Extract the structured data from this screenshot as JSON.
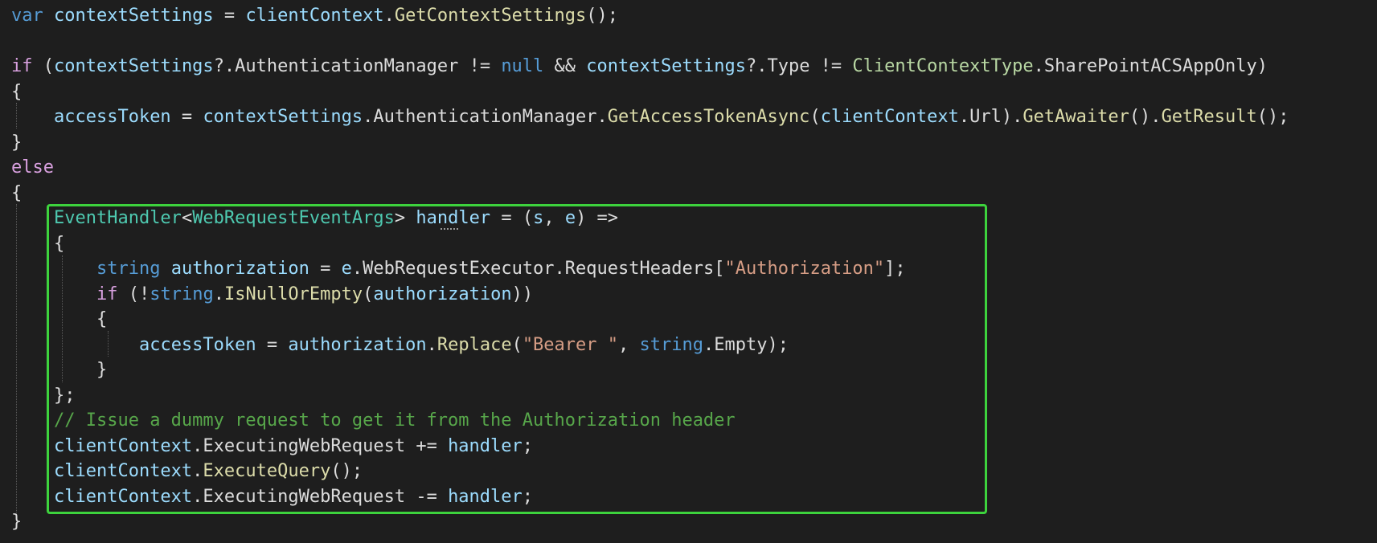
{
  "colors": {
    "background": "#1e1e1e",
    "highlight_border": "#3dd33d",
    "keyword": "#569cd6",
    "control_keyword": "#d8a0df",
    "identifier": "#9cdcfe",
    "method": "#dcdcaa",
    "type": "#4ec9b0",
    "enum": "#b8d7a3",
    "string": "#d69d85",
    "comment": "#57a64a",
    "punctuation": "#dcdcdc"
  },
  "code": [
    {
      "indent": 0,
      "tokens": [
        {
          "t": "var",
          "c": "kw"
        },
        {
          "t": " ",
          "c": "pn"
        },
        {
          "t": "contextSettings",
          "c": "id"
        },
        {
          "t": " = ",
          "c": "pn"
        },
        {
          "t": "clientContext",
          "c": "id"
        },
        {
          "t": ".",
          "c": "pn"
        },
        {
          "t": "GetContextSettings",
          "c": "mth"
        },
        {
          "t": "();",
          "c": "pn"
        }
      ]
    },
    {
      "indent": 0,
      "tokens": []
    },
    {
      "indent": 0,
      "tokens": [
        {
          "t": "if",
          "c": "ctl"
        },
        {
          "t": " (",
          "c": "pn"
        },
        {
          "t": "contextSettings",
          "c": "id"
        },
        {
          "t": "?.AuthenticationManager != ",
          "c": "pn"
        },
        {
          "t": "null",
          "c": "kw"
        },
        {
          "t": " && ",
          "c": "pn"
        },
        {
          "t": "contextSettings",
          "c": "id"
        },
        {
          "t": "?.Type != ",
          "c": "pn"
        },
        {
          "t": "ClientContextType",
          "c": "enum"
        },
        {
          "t": ".SharePointACSAppOnly)",
          "c": "pn"
        }
      ]
    },
    {
      "indent": 0,
      "tokens": [
        {
          "t": "{",
          "c": "pn"
        }
      ]
    },
    {
      "indent": 1,
      "tokens": [
        {
          "t": "accessToken",
          "c": "id"
        },
        {
          "t": " = ",
          "c": "pn"
        },
        {
          "t": "contextSettings",
          "c": "id"
        },
        {
          "t": ".AuthenticationManager.",
          "c": "pn"
        },
        {
          "t": "GetAccessTokenAsync",
          "c": "mth"
        },
        {
          "t": "(",
          "c": "pn"
        },
        {
          "t": "clientContext",
          "c": "id"
        },
        {
          "t": ".Url).",
          "c": "pn"
        },
        {
          "t": "GetAwaiter",
          "c": "mth"
        },
        {
          "t": "().",
          "c": "pn"
        },
        {
          "t": "GetResult",
          "c": "mth"
        },
        {
          "t": "();",
          "c": "pn"
        }
      ]
    },
    {
      "indent": 0,
      "tokens": [
        {
          "t": "}",
          "c": "pn"
        }
      ]
    },
    {
      "indent": 0,
      "tokens": [
        {
          "t": "else",
          "c": "ctl"
        }
      ]
    },
    {
      "indent": 0,
      "tokens": [
        {
          "t": "{",
          "c": "pn"
        }
      ]
    },
    {
      "indent": 1,
      "tokens": [
        {
          "t": "EventHandler",
          "c": "typ"
        },
        {
          "t": "<",
          "c": "pn"
        },
        {
          "t": "WebRequestEventArgs",
          "c": "typ"
        },
        {
          "t": "> ",
          "c": "pn"
        },
        {
          "t": "handler",
          "c": "id"
        },
        {
          "t": " = (",
          "c": "pn"
        },
        {
          "t": "s",
          "c": "id"
        },
        {
          "t": ", ",
          "c": "pn"
        },
        {
          "t": "e",
          "c": "id"
        },
        {
          "t": ") =>",
          "c": "pn"
        }
      ]
    },
    {
      "indent": 1,
      "tokens": [
        {
          "t": "{",
          "c": "pn"
        }
      ]
    },
    {
      "indent": 2,
      "tokens": [
        {
          "t": "string",
          "c": "kw"
        },
        {
          "t": " ",
          "c": "pn"
        },
        {
          "t": "authorization",
          "c": "id"
        },
        {
          "t": " = ",
          "c": "pn"
        },
        {
          "t": "e",
          "c": "id"
        },
        {
          "t": ".WebRequestExecutor.RequestHeaders[",
          "c": "pn"
        },
        {
          "t": "\"Authorization\"",
          "c": "str"
        },
        {
          "t": "];",
          "c": "pn"
        }
      ]
    },
    {
      "indent": 2,
      "tokens": [
        {
          "t": "if",
          "c": "ctl"
        },
        {
          "t": " (!",
          "c": "pn"
        },
        {
          "t": "string",
          "c": "kw"
        },
        {
          "t": ".",
          "c": "pn"
        },
        {
          "t": "IsNullOrEmpty",
          "c": "mth"
        },
        {
          "t": "(",
          "c": "pn"
        },
        {
          "t": "authorization",
          "c": "id"
        },
        {
          "t": "))",
          "c": "pn"
        }
      ]
    },
    {
      "indent": 2,
      "tokens": [
        {
          "t": "{",
          "c": "pn"
        }
      ]
    },
    {
      "indent": 3,
      "tokens": [
        {
          "t": "accessToken",
          "c": "id"
        },
        {
          "t": " = ",
          "c": "pn"
        },
        {
          "t": "authorization",
          "c": "id"
        },
        {
          "t": ".",
          "c": "pn"
        },
        {
          "t": "Replace",
          "c": "mth"
        },
        {
          "t": "(",
          "c": "pn"
        },
        {
          "t": "\"Bearer \"",
          "c": "str"
        },
        {
          "t": ", ",
          "c": "pn"
        },
        {
          "t": "string",
          "c": "kw"
        },
        {
          "t": ".Empty);",
          "c": "pn"
        }
      ]
    },
    {
      "indent": 2,
      "tokens": [
        {
          "t": "}",
          "c": "pn"
        }
      ]
    },
    {
      "indent": 1,
      "tokens": [
        {
          "t": "};",
          "c": "pn"
        }
      ]
    },
    {
      "indent": 1,
      "tokens": [
        {
          "t": "// Issue a dummy request to get it from the Authorization header",
          "c": "cmt"
        }
      ]
    },
    {
      "indent": 1,
      "tokens": [
        {
          "t": "clientContext",
          "c": "id"
        },
        {
          "t": ".ExecutingWebRequest += ",
          "c": "pn"
        },
        {
          "t": "handler",
          "c": "id"
        },
        {
          "t": ";",
          "c": "pn"
        }
      ]
    },
    {
      "indent": 1,
      "tokens": [
        {
          "t": "clientContext",
          "c": "id"
        },
        {
          "t": ".",
          "c": "pn"
        },
        {
          "t": "ExecuteQuery",
          "c": "mth"
        },
        {
          "t": "();",
          "c": "pn"
        }
      ]
    },
    {
      "indent": 1,
      "tokens": [
        {
          "t": "clientContext",
          "c": "id"
        },
        {
          "t": ".ExecutingWebRequest -= ",
          "c": "pn"
        },
        {
          "t": "handler",
          "c": "id"
        },
        {
          "t": ";",
          "c": "pn"
        }
      ]
    },
    {
      "indent": 0,
      "tokens": [
        {
          "t": "}",
          "c": "pn"
        }
      ]
    }
  ]
}
